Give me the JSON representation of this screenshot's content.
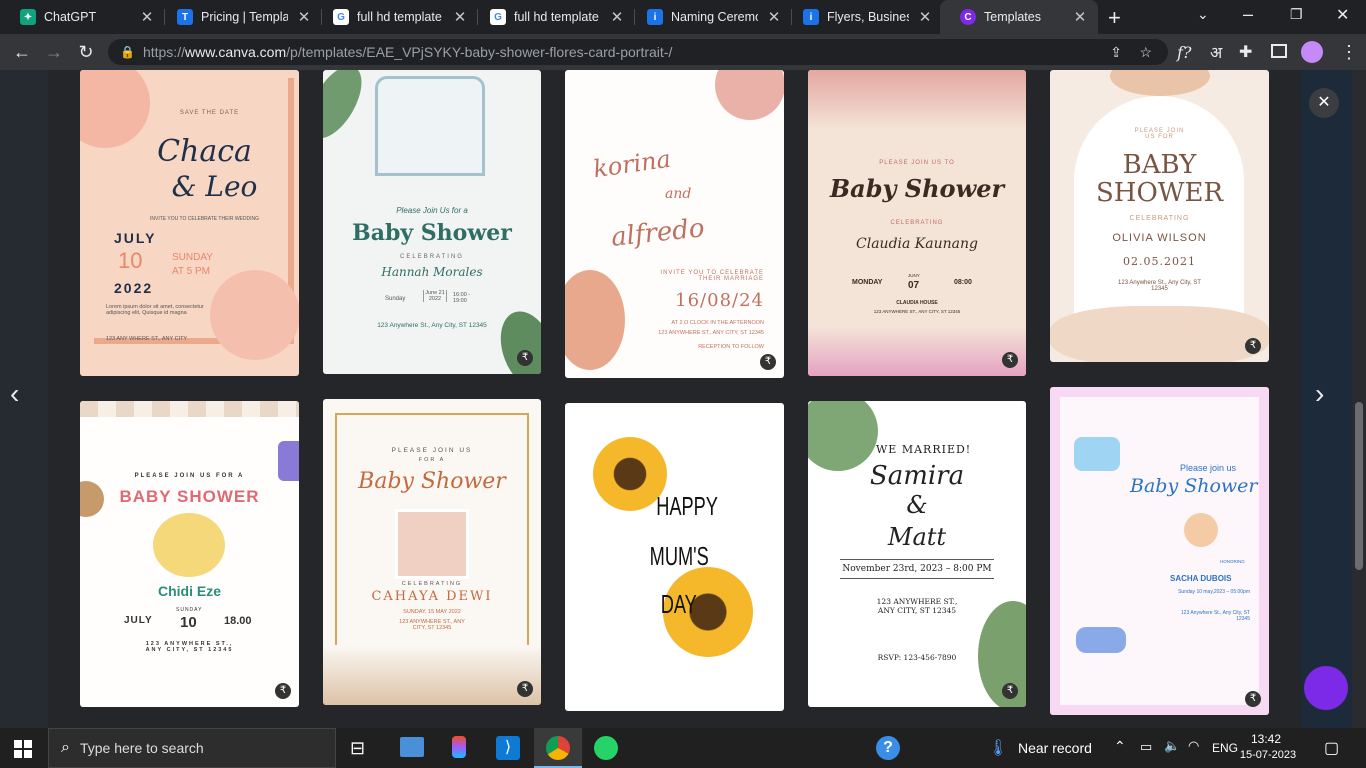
{
  "browser": {
    "tabs": [
      {
        "title": "ChatGPT",
        "color": "#10a37f",
        "glyph": "✦"
      },
      {
        "title": "Pricing | Template",
        "color": "#1a73e8",
        "glyph": "T"
      },
      {
        "title": "full hd template c",
        "color": "#fff",
        "glyph": "G"
      },
      {
        "title": "full hd template c",
        "color": "#fff",
        "glyph": "G"
      },
      {
        "title": "Naming Ceremo",
        "color": "#1a73e8",
        "glyph": "i"
      },
      {
        "title": "Flyers, Business C",
        "color": "#1a73e8",
        "glyph": "i"
      },
      {
        "title": "Templates",
        "color": "#7d2ae8",
        "glyph": "C"
      }
    ],
    "new_tab": "+",
    "url_prefix": "https://",
    "url_host": "www.canva.com",
    "url_path": "/p/templates/EAE_VPjSYKY-baby-shower-flores-card-portrait-/"
  },
  "cards": {
    "c1": {
      "l1": "SAVE THE DATE",
      "l2": "Chaca",
      "l3": "& Leo",
      "l4": "INVITE YOU TO CELEBRATE THEIR WEDDING",
      "l5": "JULY",
      "l6": "10",
      "l7": "2022",
      "l8": "SUNDAY",
      "l9": "AT 5 PM",
      "l10": "Lorem ipsum dolor sit amet, consectetur adipiscing elit, Quisque id magna",
      "l11": "123 ANY WHERE ST., ANY CITY"
    },
    "c2": {
      "l1": "Please Join Us for a",
      "l2": "Baby Shower",
      "l3": "CELEBRATING",
      "l4": "Hannah Morales",
      "l5": "Sunday",
      "l6": "June 21 2022",
      "l7": "16:00 - 19:00",
      "l8": "123 Anywhere St., Any City, ST 12345"
    },
    "c3": {
      "l1": "korina",
      "l2": "and",
      "l3": "alfredo",
      "l4": "INVITE YOU TO CELEBRATE THEIR MARRIAGE",
      "l5": "16/08/24",
      "l6": "AT 2 O CLOCK IN THE AFTERNOON",
      "l7": "123 ANYWHERE ST., ANY CITY, ST 12345",
      "l8": "RECEPTION TO FOLLOW"
    },
    "c4": {
      "l1": "PLEASE JOIN US TO",
      "l2": "Baby Shower",
      "l3": "CELEBRATING",
      "l4": "Claudia Kaunang",
      "l5": "MONDAY",
      "l6": "JUNY",
      "l7": "07",
      "l8": "08:00",
      "l9": "CLAUDIA HOUSE",
      "l10": "123 ANYWHERE ST., ANY CITY, ST 12345"
    },
    "c5": {
      "l1": "PLEASE JOIN US FOR",
      "l2": "BABY",
      "l3": "SHOWER",
      "l4": "CELEBRATING",
      "l5": "OLIVIA WILSON",
      "l6": "02.05.2021",
      "l7": "123 Anywhere St., Any City, ST 12345"
    },
    "c6": {
      "l1": "PLEASE JOIN US FOR A",
      "l2": "BABY SHOWER",
      "l3": "Chidi Eze",
      "l4": "JULY",
      "l5": "SUNDAY",
      "l6": "10",
      "l7": "18.00",
      "l8": "123 ANYWHERE ST., ANY CITY, ST 12345"
    },
    "c7": {
      "l1": "PLEASE JOIN US",
      "l2": "FOR A",
      "l3": "Baby Shower",
      "l4": "CELEBRATING",
      "l5": "CAHAYA DEWI",
      "l6": "SUNDAY, 15 MAY 2022",
      "l7": "123 ANYWHERE ST., ANY CITY, ST 12345"
    },
    "c8": {
      "l1": "HAPPY",
      "l2": "MUM'S",
      "l3": "DAY"
    },
    "c9": {
      "l1": "WE MARRIED!",
      "l2": "Samira",
      "l3": "&",
      "l4": "Matt",
      "l5": "November 23rd, 2023 – 8:00 PM",
      "l6": "123 ANYWHERE ST., ANY CITY, ST 12345",
      "l7": "RSVP: 123-456-7890"
    },
    "c10": {
      "l1": "Please join us",
      "l2": "Baby Shower",
      "l3": "HONORING",
      "l4": "SACHA DUBOIS",
      "l5": "Sunday 10 may,2023 – 05:00pm",
      "l6": "123 Anywhere St., Any City, ST 12345"
    }
  },
  "price_symbol": "₹",
  "taskbar": {
    "search_placeholder": "Type here to search",
    "weather": "Near record",
    "lang": "ENG",
    "time": "13:42",
    "date": "15-07-2023"
  }
}
